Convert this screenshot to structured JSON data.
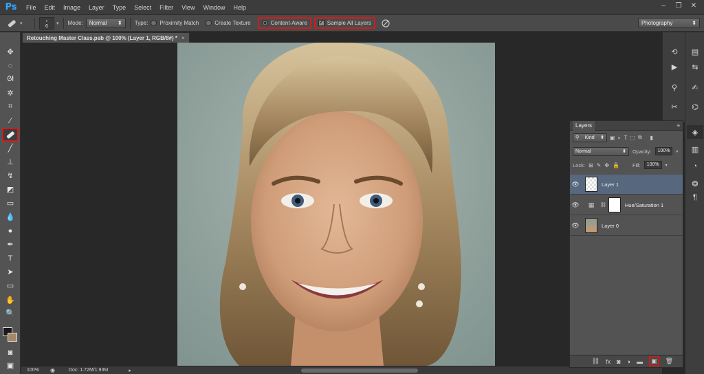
{
  "app": {
    "logo": "Ps",
    "menu": [
      "File",
      "Edit",
      "Image",
      "Layer",
      "Type",
      "Select",
      "Filter",
      "View",
      "Window",
      "Help"
    ],
    "window_controls": [
      "–",
      "❐",
      "✕"
    ]
  },
  "options": {
    "brush_size": "6",
    "mode_label": "Mode:",
    "mode_value": "Normal",
    "type_label": "Type:",
    "type_options": [
      "Proximity Match",
      "Create Texture",
      "Content-Aware"
    ],
    "selected_type": "Content-Aware",
    "sample_all_layers_label": "Sample All Layers",
    "sample_all_layers_checked": true,
    "workspace": "Photography"
  },
  "document": {
    "tab_title": "Retouching Master Class.psb @ 100% (Layer 1, RGB/8#) *",
    "close_symbol": "×",
    "zoom": "100%",
    "doc_size": "Doc: 1.72M/1.93M"
  },
  "layers_panel": {
    "tab_label": "Layers",
    "filter_label": "Kind",
    "blend_mode": "Normal",
    "opacity_label": "Opacity:",
    "opacity_value": "100%",
    "lock_label": "Lock:",
    "fill_label": "Fill:",
    "fill_value": "100%",
    "layers": [
      {
        "name": "Layer 1",
        "selected": true
      },
      {
        "name": "Hue/Saturation 1",
        "selected": false
      },
      {
        "name": "Layer 0",
        "selected": false
      }
    ]
  },
  "colors": {
    "highlight": "#d01c1c",
    "selected_layer": "#56677e",
    "ps_blue": "#31a8ff"
  }
}
